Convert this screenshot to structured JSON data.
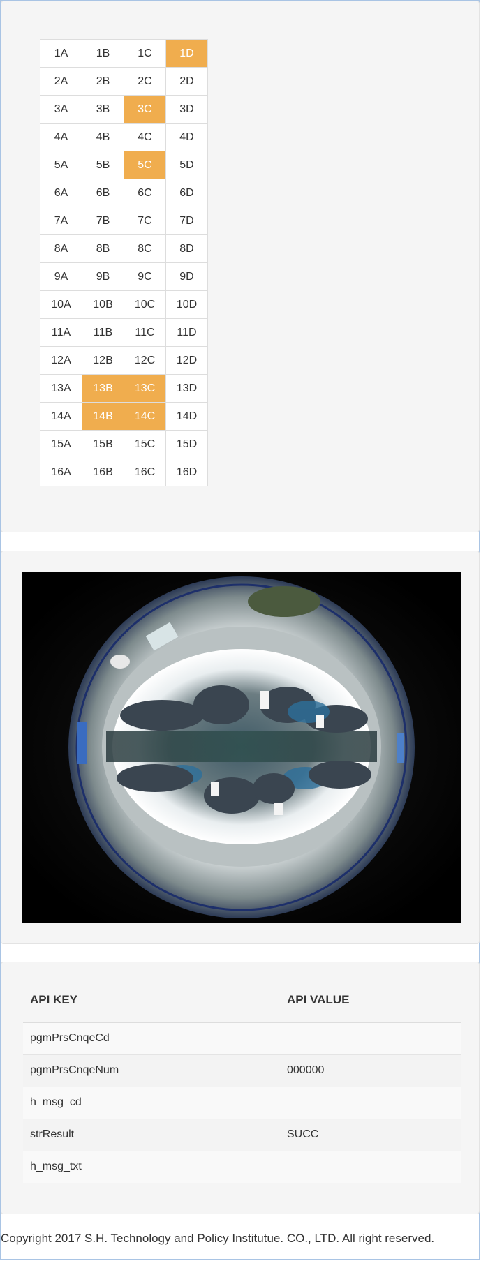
{
  "seat_map": {
    "rows": [
      {
        "seats": [
          {
            "label": "1A",
            "occupied": false
          },
          {
            "label": "1B",
            "occupied": false
          },
          {
            "label": "1C",
            "occupied": false
          },
          {
            "label": "1D",
            "occupied": true
          }
        ]
      },
      {
        "seats": [
          {
            "label": "2A",
            "occupied": false
          },
          {
            "label": "2B",
            "occupied": false
          },
          {
            "label": "2C",
            "occupied": false
          },
          {
            "label": "2D",
            "occupied": false
          }
        ]
      },
      {
        "seats": [
          {
            "label": "3A",
            "occupied": false
          },
          {
            "label": "3B",
            "occupied": false
          },
          {
            "label": "3C",
            "occupied": true
          },
          {
            "label": "3D",
            "occupied": false
          }
        ]
      },
      {
        "seats": [
          {
            "label": "4A",
            "occupied": false
          },
          {
            "label": "4B",
            "occupied": false
          },
          {
            "label": "4C",
            "occupied": false
          },
          {
            "label": "4D",
            "occupied": false
          }
        ]
      },
      {
        "seats": [
          {
            "label": "5A",
            "occupied": false
          },
          {
            "label": "5B",
            "occupied": false
          },
          {
            "label": "5C",
            "occupied": true
          },
          {
            "label": "5D",
            "occupied": false
          }
        ]
      },
      {
        "seats": [
          {
            "label": "6A",
            "occupied": false
          },
          {
            "label": "6B",
            "occupied": false
          },
          {
            "label": "6C",
            "occupied": false
          },
          {
            "label": "6D",
            "occupied": false
          }
        ]
      },
      {
        "seats": [
          {
            "label": "7A",
            "occupied": false
          },
          {
            "label": "7B",
            "occupied": false
          },
          {
            "label": "7C",
            "occupied": false
          },
          {
            "label": "7D",
            "occupied": false
          }
        ]
      },
      {
        "seats": [
          {
            "label": "8A",
            "occupied": false
          },
          {
            "label": "8B",
            "occupied": false
          },
          {
            "label": "8C",
            "occupied": false
          },
          {
            "label": "8D",
            "occupied": false
          }
        ]
      },
      {
        "seats": [
          {
            "label": "9A",
            "occupied": false
          },
          {
            "label": "9B",
            "occupied": false
          },
          {
            "label": "9C",
            "occupied": false
          },
          {
            "label": "9D",
            "occupied": false
          }
        ]
      },
      {
        "seats": [
          {
            "label": "10A",
            "occupied": false
          },
          {
            "label": "10B",
            "occupied": false
          },
          {
            "label": "10C",
            "occupied": false
          },
          {
            "label": "10D",
            "occupied": false
          }
        ]
      },
      {
        "seats": [
          {
            "label": "11A",
            "occupied": false
          },
          {
            "label": "11B",
            "occupied": false
          },
          {
            "label": "11C",
            "occupied": false
          },
          {
            "label": "11D",
            "occupied": false
          }
        ]
      },
      {
        "seats": [
          {
            "label": "12A",
            "occupied": false
          },
          {
            "label": "12B",
            "occupied": false
          },
          {
            "label": "12C",
            "occupied": false
          },
          {
            "label": "12D",
            "occupied": false
          }
        ]
      },
      {
        "seats": [
          {
            "label": "13A",
            "occupied": false
          },
          {
            "label": "13B",
            "occupied": true
          },
          {
            "label": "13C",
            "occupied": true
          },
          {
            "label": "13D",
            "occupied": false
          }
        ]
      },
      {
        "seats": [
          {
            "label": "14A",
            "occupied": false
          },
          {
            "label": "14B",
            "occupied": true
          },
          {
            "label": "14C",
            "occupied": true
          },
          {
            "label": "14D",
            "occupied": false
          }
        ]
      },
      {
        "seats": [
          {
            "label": "15A",
            "occupied": false
          },
          {
            "label": "15B",
            "occupied": false
          },
          {
            "label": "15C",
            "occupied": false
          },
          {
            "label": "15D",
            "occupied": false
          }
        ]
      },
      {
        "seats": [
          {
            "label": "16A",
            "occupied": false
          },
          {
            "label": "16B",
            "occupied": false
          },
          {
            "label": "16C",
            "occupied": false
          },
          {
            "label": "16D",
            "occupied": false
          }
        ]
      }
    ]
  },
  "colors": {
    "occupied_seat": "#f0ad4e",
    "panel_background": "#f5f5f5",
    "seat_background": "#ffffff"
  },
  "camera": {
    "icon": "fisheye-camera-image"
  },
  "api_table": {
    "headers": {
      "key": "API KEY",
      "value": "API VALUE"
    },
    "rows": [
      {
        "key": "pgmPrsCnqeCd",
        "value": ""
      },
      {
        "key": "pgmPrsCnqeNum",
        "value": "000000"
      },
      {
        "key": "h_msg_cd",
        "value": ""
      },
      {
        "key": "strResult",
        "value": "SUCC"
      },
      {
        "key": "h_msg_txt",
        "value": ""
      }
    ]
  },
  "footer": {
    "copyright": "Copyright 2017 S.H. Technology and Policy Institutue. CO., LTD. All right reserved."
  }
}
